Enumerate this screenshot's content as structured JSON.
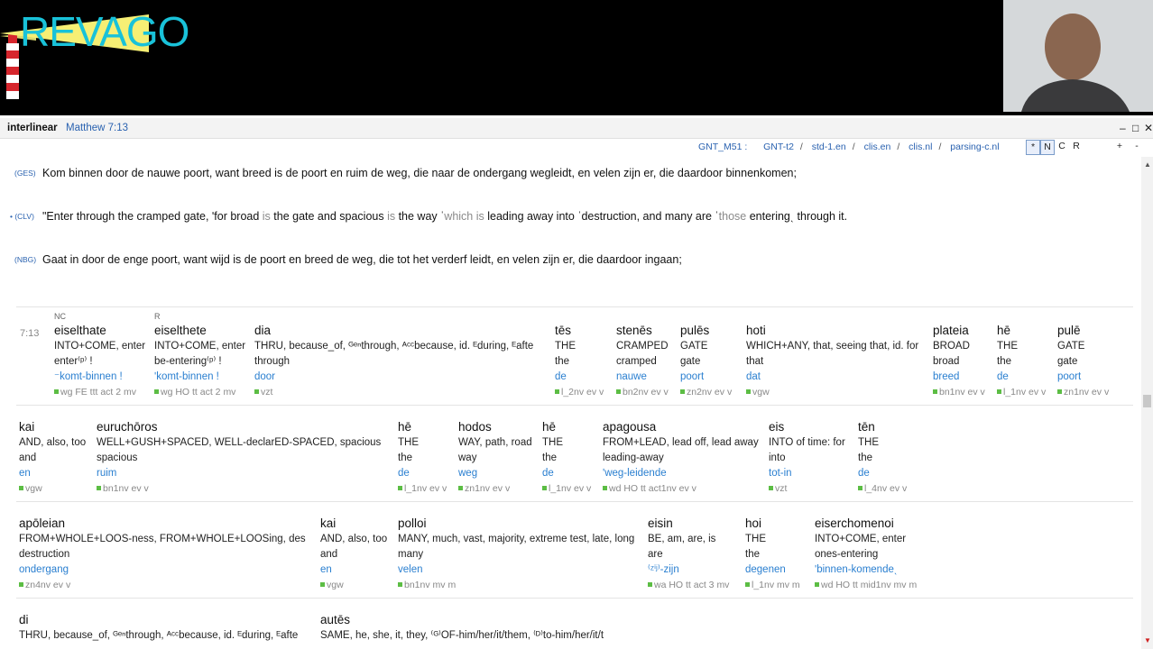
{
  "app": {
    "logo": "REVAGO",
    "title": "interlinear",
    "reference": "Matthew 7:13"
  },
  "toolbar": {
    "modules": [
      "GNT_M51 :",
      "GNT-t2",
      "std-1.en",
      "clis.en",
      "clis.nl",
      "parsing-c.nl"
    ],
    "toggles": [
      "*",
      "N",
      "C",
      "R"
    ],
    "plus": "+",
    "minus": "-"
  },
  "versions": [
    {
      "label": "(GES)",
      "text": "Kom binnen door de nauwe poort, want breed is de poort en ruim de weg, die naar de ondergang wegleidt, en velen zijn er, die daardoor binnenkomen;"
    },
    {
      "label": "• (CLV)",
      "parts": [
        "\"Enter through the cramped gate, ʹfor broad ",
        "is",
        " the gate and spacious ",
        "is",
        " the way ˈ",
        "which is",
        " leading away into ˈdestruction, and many are ˈ",
        "those",
        " enteringˎ through it."
      ]
    },
    {
      "label": "(NBG)",
      "text": "Gaat in door de enge poort, want wijd is de poort en breed de weg, die tot het verderf leidt, en velen zijn er, die daardoor ingaan;"
    }
  ],
  "verse": "7:13",
  "row1": [
    {
      "tag": "NC",
      "greek": "eiselthate",
      "gloss": [
        "INTO+COME, enter",
        "enter⁽ᵖ⁾ !"
      ],
      "dutch": "⁻komt-binnen !",
      "parse": "wg FE ttt act 2 mv"
    },
    {
      "tag": "R",
      "greek": "eiselthete",
      "gloss": [
        "INTO+COME, enter",
        "be-entering⁽ᵖ⁾ !"
      ],
      "dutch": "ʹkomt-binnen !",
      "parse": "wg HO tt act 2 mv"
    },
    {
      "greek": "dia",
      "gloss": [
        "THRU, because_of, ᴳᵉⁿthrough, ᴬᶜᶜbecause,  id. ᴱduring, ᴱafte",
        "through"
      ],
      "dutch": "door",
      "parse": "vzt"
    },
    {
      "greek": "tēs",
      "gloss": [
        "THE",
        "the"
      ],
      "dutch": "de",
      "parse": "l_2nv ev v"
    },
    {
      "greek": "stenēs",
      "gloss": [
        "CRAMPED",
        "cramped"
      ],
      "dutch": "nauwe",
      "parse": "bn2nv ev v"
    },
    {
      "greek": "pulēs",
      "gloss": [
        "GATE",
        "gate"
      ],
      "dutch": "poort",
      "parse": "zn2nv ev v"
    },
    {
      "greek": "hoti",
      "gloss": [
        "WHICH+ANY, that, seeing that,  id. for",
        "that"
      ],
      "dutch": "dat",
      "parse": "vgw"
    },
    {
      "greek": "plateia",
      "gloss": [
        "BROAD",
        "broad"
      ],
      "dutch": "breed",
      "parse": "bn1nv ev v"
    },
    {
      "greek": "hē",
      "gloss": [
        "THE",
        "the"
      ],
      "dutch": "de",
      "parse": "l_1nv ev v"
    },
    {
      "greek": "pulē",
      "gloss": [
        "GATE",
        "gate"
      ],
      "dutch": "poort",
      "parse": "zn1nv ev v"
    }
  ],
  "row2": [
    {
      "greek": "kai",
      "gloss": [
        "AND, also, too",
        "and"
      ],
      "dutch": "en",
      "parse": "vgw"
    },
    {
      "greek": "euruchōros",
      "gloss": [
        "WELL+GUSH+SPACED, WELL-declarED-SPACED, spacious",
        "spacious"
      ],
      "dutch": "ruim",
      "parse": "bn1nv ev v"
    },
    {
      "greek": "hē",
      "gloss": [
        "THE",
        "the"
      ],
      "dutch": "de",
      "parse": "l_1nv ev v"
    },
    {
      "greek": "hodos",
      "gloss": [
        "WAY, path, road",
        "way"
      ],
      "dutch": "weg",
      "parse": "zn1nv ev v"
    },
    {
      "greek": "hē",
      "gloss": [
        "THE",
        "the"
      ],
      "dutch": "de",
      "parse": "l_1nv ev v"
    },
    {
      "greek": "apagousa",
      "gloss": [
        "FROM+LEAD, lead off, lead away",
        "leading-away"
      ],
      "dutch": "ʹweg-leidende",
      "parse": "wd HO tt act1nv ev v"
    },
    {
      "greek": "eis",
      "gloss": [
        "INTO  of time: for",
        "into"
      ],
      "dutch": "tot-in",
      "parse": "vzt"
    },
    {
      "greek": "tēn",
      "gloss": [
        "THE",
        "the"
      ],
      "dutch": "de",
      "parse": "l_4nv ev v"
    }
  ],
  "row3": [
    {
      "greek": "apōleian",
      "gloss": [
        "FROM+WHOLE+LOOS-ness, FROM+WHOLE+LOOSing, des",
        "destruction"
      ],
      "dutch": "ondergang",
      "parse": "zn4nv ev v"
    },
    {
      "greek": "kai",
      "gloss": [
        "AND, also, too",
        "and"
      ],
      "dutch": "en",
      "parse": "vgw"
    },
    {
      "greek": "polloi",
      "gloss": [
        "MANY, much, vast, majority, extreme test, late, long",
        "many"
      ],
      "dutch": "velen",
      "parse": "bn1nv mv m"
    },
    {
      "greek": "eisin",
      "gloss": [
        "BE, am, are, is",
        "are"
      ],
      "dutch": "⁽ᶻⁱʲ⁾-zijn",
      "parse": "wa HO tt act 3 mv"
    },
    {
      "greek": "hoi",
      "gloss": [
        "THE",
        "the"
      ],
      "dutch": "degenen",
      "parse": "l_1nv mv m"
    },
    {
      "greek": "eiserchomenoi",
      "gloss": [
        "INTO+COME, enter",
        "ones-entering"
      ],
      "dutch": "ʹbinnen-komendeˎ",
      "parse": "wd HO tt mid1nv mv m"
    }
  ],
  "row4": [
    {
      "greek": "di",
      "gloss": [
        "THRU, because_of, ᴳᵉⁿthrough, ᴬᶜᶜbecause,  id. ᴱduring, ᴱafte"
      ]
    },
    {
      "greek": "autēs",
      "gloss": [
        "SAME, he, she, it, they, ⁽ᴳ⁾OF-him/her/it/them, ⁽ᴰ⁾to-him/her/it/t"
      ]
    }
  ]
}
